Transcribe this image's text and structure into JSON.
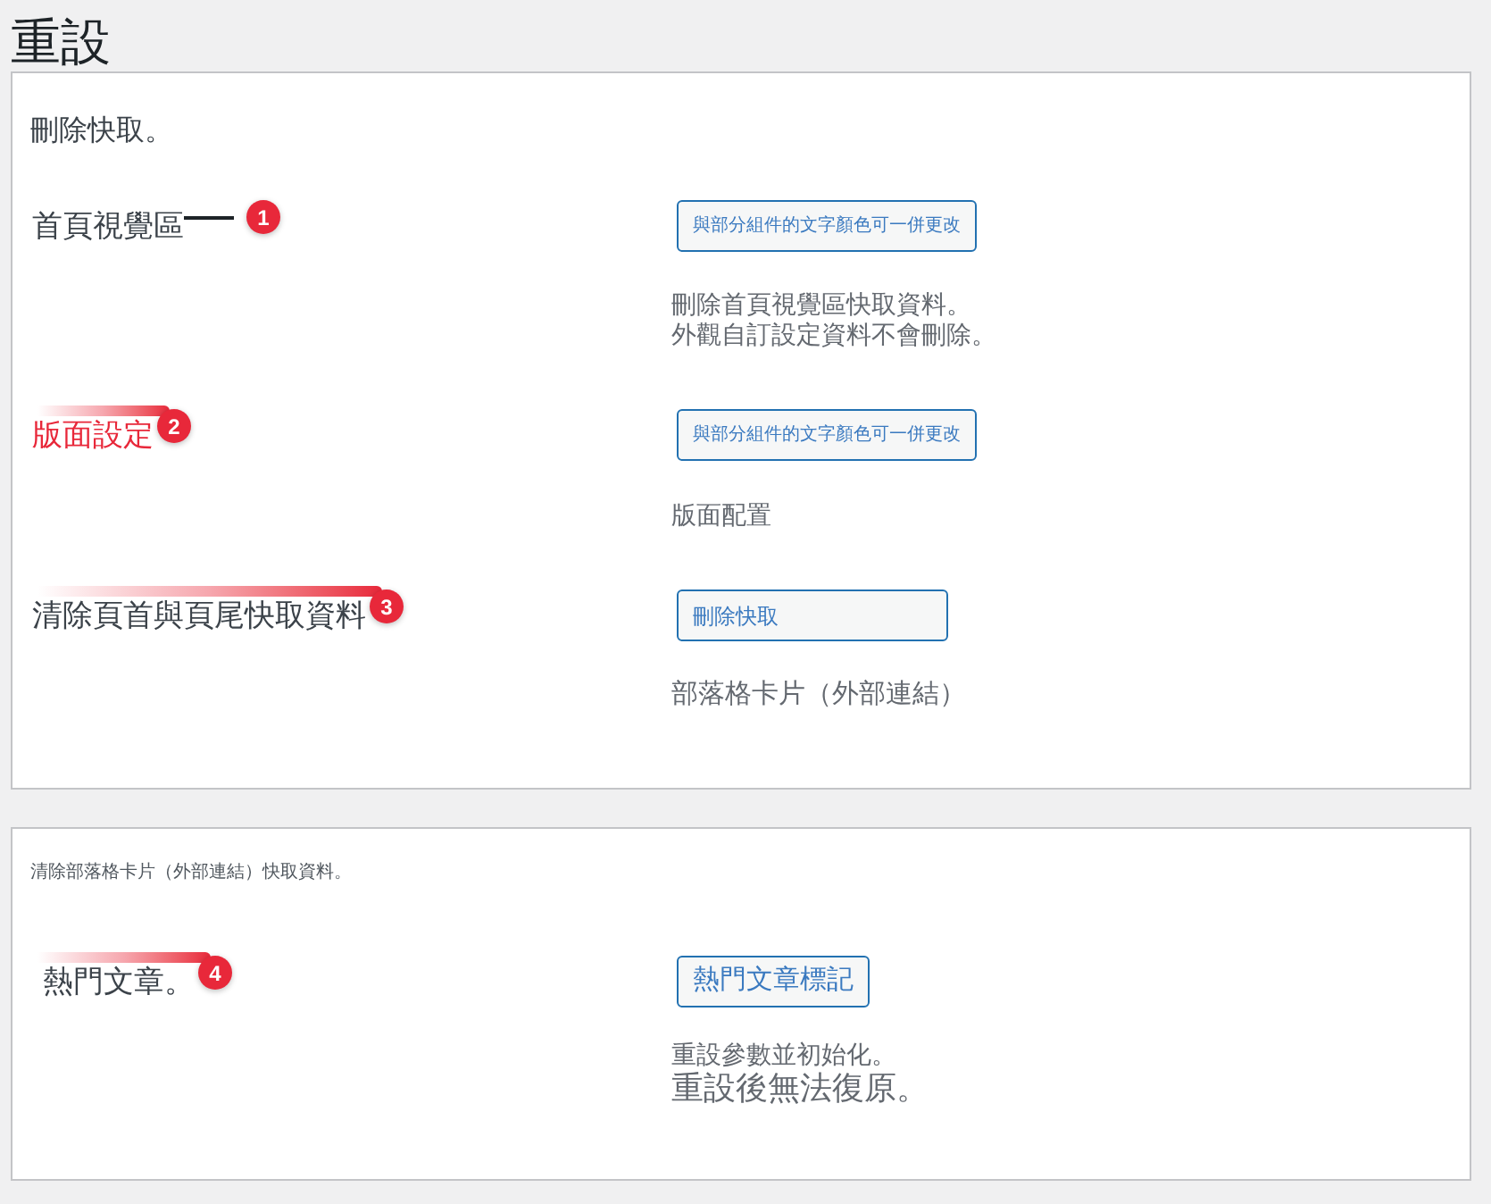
{
  "page_title": "重設",
  "sections": [
    {
      "intro": "刪除快取。",
      "rows": [
        {
          "label": "首頁視覺區",
          "emphasized": false,
          "annotation": {
            "kind": "leader",
            "number": "1"
          },
          "button": "與部分組件的文字顏色可一併更改",
          "description": [
            "刪除首頁視覺區快取資料。",
            "外觀自訂設定資料不會刪除。"
          ]
        },
        {
          "label": "版面設定",
          "emphasized": true,
          "annotation": {
            "kind": "streak",
            "number": "2"
          },
          "button": "與部分組件的文字顏色可一併更改",
          "description": [
            "版面配置"
          ]
        },
        {
          "label": "清除頁首與頁尾快取資料",
          "emphasized": false,
          "annotation": {
            "kind": "streak",
            "number": "3"
          },
          "button": "刪除快取",
          "description": [
            "部落格卡片（外部連結）"
          ]
        }
      ]
    },
    {
      "intro": "清除部落格卡片（外部連結）快取資料。",
      "rows": [
        {
          "label": "熱門文章。",
          "emphasized": false,
          "annotation": {
            "kind": "streak",
            "number": "4"
          },
          "button": "熱門文章標記",
          "description": [
            "重設參數並初始化。",
            "重設後無法復原。"
          ]
        }
      ]
    }
  ]
}
